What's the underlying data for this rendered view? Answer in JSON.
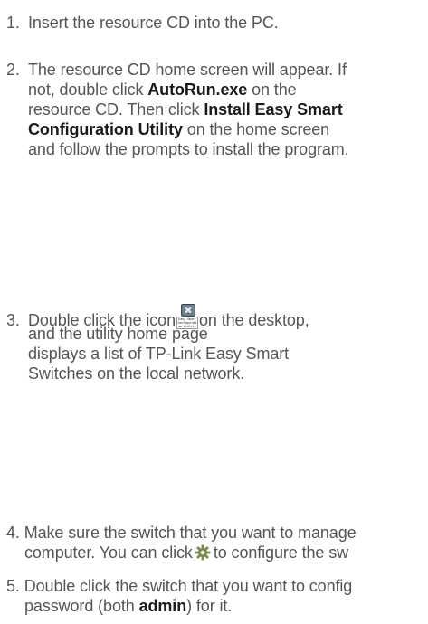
{
  "steps": [
    {
      "number": "1.",
      "text": "Insert the resource CD into the PC."
    },
    {
      "number": "2.",
      "line1": "The resource CD home screen will appear. If",
      "line2_pre": "not, double click ",
      "line2_bold": "AutoRun.exe",
      "line2_post": " on the",
      "line3_pre": "resource CD. Then click ",
      "line3_bold": "Install Easy Smart",
      "line4_bold": "Configuration Utility",
      "line4_post": " on the home screen",
      "line5": "and follow the prompts to install the program."
    },
    {
      "number": "3.",
      "line1_pre": "Double click the icon",
      "icon_caption": "Easy Smart Configurati on Utility",
      "line1_post": "on the desktop,",
      "line2": "and the utility home page",
      "line3": "displays a list of TP-Link Easy Smart",
      "line4": "Switches on the local network."
    },
    {
      "number": "4.",
      "line1": "Make sure the switch that you want to manage",
      "line2_pre": "computer. You can click",
      "line2_post": "to configure the sw"
    },
    {
      "number": "5.",
      "line1": "Double click the switch that you want to config",
      "line2_pre": "password (both ",
      "line2_bold": "admin",
      "line2_post": ") for it."
    }
  ],
  "icons": {
    "app": "easy-smart-configuration-utility-icon",
    "settings": "gear-icon"
  }
}
